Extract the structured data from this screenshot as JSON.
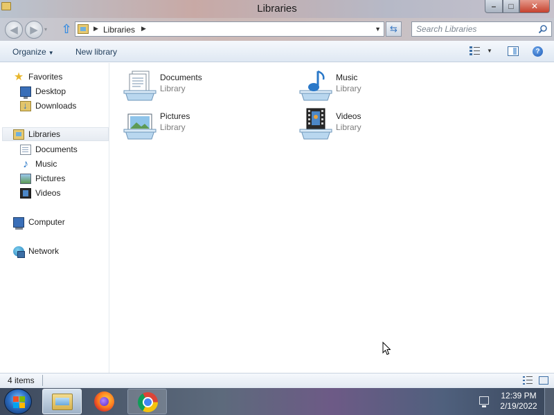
{
  "window": {
    "title": "Libraries",
    "minimize_label": "–",
    "maximize_label": "□",
    "close_label": "✕"
  },
  "address_bar": {
    "crumb": "Libraries",
    "arrow": "▶",
    "dropdown": "▼",
    "refresh": "⇆"
  },
  "navigation": {
    "back": "◀",
    "forward": "▶",
    "history_dropdown": "▾",
    "up": "⇧"
  },
  "search": {
    "placeholder": "Search Libraries"
  },
  "toolbar": {
    "organize_label": "Organize",
    "organize_caret": "▼",
    "new_library_label": "New library",
    "views_caret": "▼",
    "help_label": "?"
  },
  "nav_pane": {
    "favorites": {
      "label": "Favorites",
      "icon": "star-icon",
      "items": [
        {
          "label": "Desktop",
          "icon": "desktop-icon"
        },
        {
          "label": "Downloads",
          "icon": "downloads-icon"
        }
      ]
    },
    "libraries": {
      "label": "Libraries",
      "icon": "libraries-icon",
      "items": [
        {
          "label": "Documents",
          "icon": "documents-icon"
        },
        {
          "label": "Music",
          "icon": "music-icon"
        },
        {
          "label": "Pictures",
          "icon": "pictures-icon"
        },
        {
          "label": "Videos",
          "icon": "videos-icon"
        }
      ]
    },
    "computer": {
      "label": "Computer",
      "icon": "computer-icon"
    },
    "network": {
      "label": "Network",
      "icon": "network-icon"
    }
  },
  "libraries": [
    {
      "name": "Documents",
      "type": "Library",
      "icon": "documents-library-icon"
    },
    {
      "name": "Music",
      "type": "Library",
      "icon": "music-library-icon"
    },
    {
      "name": "Pictures",
      "type": "Library",
      "icon": "pictures-library-icon"
    },
    {
      "name": "Videos",
      "type": "Library",
      "icon": "videos-library-icon"
    }
  ],
  "status_bar": {
    "item_count": "4 items"
  },
  "taskbar": {
    "apps": [
      {
        "name": "Windows Explorer",
        "icon": "explorer-icon",
        "active": true
      },
      {
        "name": "Firefox",
        "icon": "firefox-icon",
        "active": false
      },
      {
        "name": "Google Chrome",
        "icon": "chrome-icon",
        "active": false
      }
    ],
    "clock_time": "12:39 PM",
    "clock_date": "2/19/2022"
  },
  "colors": {
    "accent": "#3b6ea5",
    "toolbar_text": "#1e3c5a",
    "secondary_text": "#7c7c7c"
  }
}
